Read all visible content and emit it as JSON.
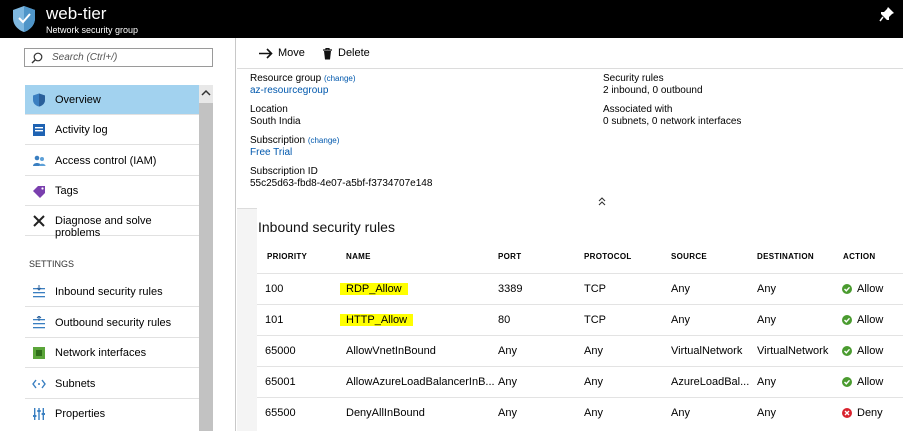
{
  "window": {
    "title": "web-tier",
    "subtitle": "Network security group",
    "pin_icon": "pin-icon"
  },
  "sidebar": {
    "search_placeholder": "Search (Ctrl+/)",
    "items": [
      {
        "label": "Overview",
        "icon": "shield-icon",
        "active": true
      },
      {
        "label": "Activity log",
        "icon": "activity-log-icon"
      },
      {
        "label": "Access control (IAM)",
        "icon": "users-icon"
      },
      {
        "label": "Tags",
        "icon": "tag-icon"
      },
      {
        "label": "Diagnose and solve problems",
        "icon": "wrench-icon"
      }
    ],
    "settings_header": "SETTINGS",
    "settings_items": [
      {
        "label": "Inbound security rules",
        "icon": "inbound-icon"
      },
      {
        "label": "Outbound security rules",
        "icon": "outbound-icon"
      },
      {
        "label": "Network interfaces",
        "icon": "network-interface-icon"
      },
      {
        "label": "Subnets",
        "icon": "subnet-icon"
      },
      {
        "label": "Properties",
        "icon": "properties-icon"
      }
    ]
  },
  "toolbar": {
    "move_label": "Move",
    "delete_label": "Delete"
  },
  "essentials": {
    "resource_group_label": "Resource group",
    "resource_group_change": "(change)",
    "resource_group_value": "az-resourcegroup",
    "location_label": "Location",
    "location_value": "South India",
    "subscription_label": "Subscription",
    "subscription_change": "(change)",
    "subscription_value": "Free Trial",
    "subscription_id_label": "Subscription ID",
    "subscription_id_value": "55c25d63-fbd8-4e07-a5bf-f3734707e148",
    "security_rules_label": "Security rules",
    "security_rules_value": "2 inbound, 0 outbound",
    "associated_label": "Associated with",
    "associated_value": "0 subnets, 0 network interfaces"
  },
  "inbound": {
    "title": "Inbound security rules",
    "columns": [
      "PRIORITY",
      "NAME",
      "PORT",
      "PROTOCOL",
      "SOURCE",
      "DESTINATION",
      "ACTION"
    ],
    "rows": [
      {
        "priority": "100",
        "name": "RDP_Allow",
        "port": "3389",
        "protocol": "TCP",
        "source": "Any",
        "destination": "Any",
        "action": "Allow",
        "highlight": true
      },
      {
        "priority": "101",
        "name": "HTTP_Allow",
        "port": "80",
        "protocol": "TCP",
        "source": "Any",
        "destination": "Any",
        "action": "Allow",
        "highlight": true
      },
      {
        "priority": "65000",
        "name": "AllowVnetInBound",
        "port": "Any",
        "protocol": "Any",
        "source": "VirtualNetwork",
        "destination": "VirtualNetwork",
        "action": "Allow"
      },
      {
        "priority": "65001",
        "name": "AllowAzureLoadBalancerInB...",
        "port": "Any",
        "protocol": "Any",
        "source": "AzureLoadBal...",
        "destination": "Any",
        "action": "Allow"
      },
      {
        "priority": "65500",
        "name": "DenyAllInBound",
        "port": "Any",
        "protocol": "Any",
        "source": "Any",
        "destination": "Any",
        "action": "Deny"
      }
    ],
    "colors": {
      "allow": "#4a9b2f",
      "deny": "#d9232e",
      "highlight": "#ffff00",
      "link": "#0058ad",
      "active_nav": "#a2d2ef"
    }
  }
}
